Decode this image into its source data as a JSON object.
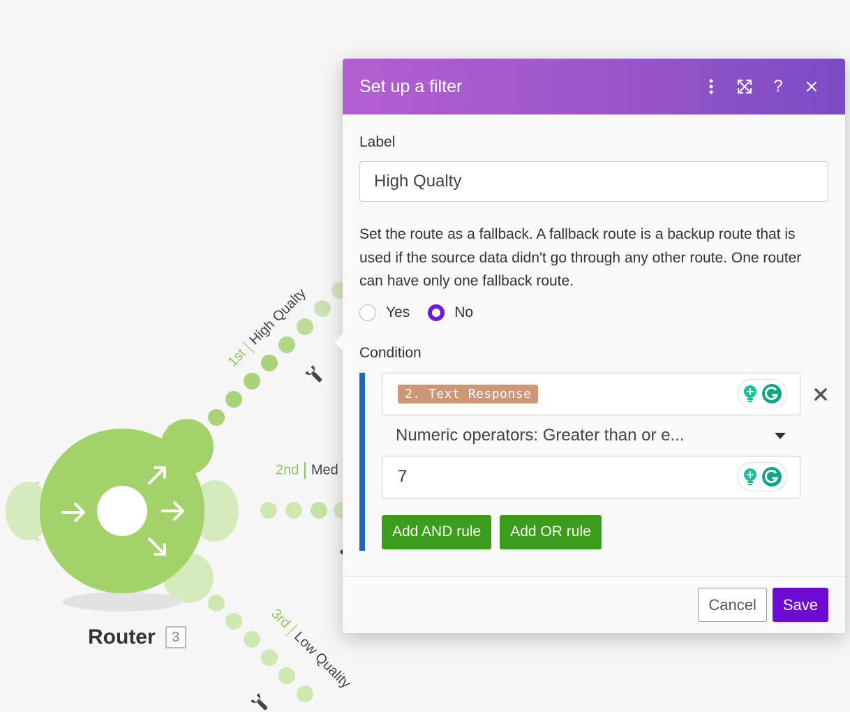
{
  "scenario": {
    "router": {
      "name": "Router",
      "badge": "3"
    },
    "routes": [
      {
        "order": "1st",
        "name": "High Qualty"
      },
      {
        "order": "2nd",
        "name": "Med"
      },
      {
        "order": "3rd",
        "name": "Low Quality"
      }
    ],
    "colors": {
      "module": "#a3d26b",
      "module_light": "#cfe8b0",
      "route_dot": "#a8d37a"
    }
  },
  "dialog": {
    "title": "Set up a filter",
    "header_icons": [
      "more-vertical-icon",
      "expand-icon",
      "help-icon",
      "close-icon"
    ],
    "label_field": {
      "label": "Label",
      "value": "High Qualty"
    },
    "fallback": {
      "description": "Set the route as a fallback. A fallback route is a backup route that is used if the source data didn't go through any other route. One router can have only one fallback route.",
      "options": [
        "Yes",
        "No"
      ],
      "selected": "No"
    },
    "condition": {
      "label": "Condition",
      "operand_pill": "2. Text Response",
      "operator": "Numeric operators: Greater than or e...",
      "value": "7",
      "add_and": "Add AND rule",
      "add_or": "Add OR rule"
    },
    "footer": {
      "cancel": "Cancel",
      "save": "Save"
    },
    "colors": {
      "header_start": "#b35fd1",
      "header_end": "#7a4cc4",
      "save": "#6d0ad4",
      "add_rule": "#3c9c1b",
      "condition_bar": "#1e68b8",
      "pill": "#cf9577"
    }
  }
}
